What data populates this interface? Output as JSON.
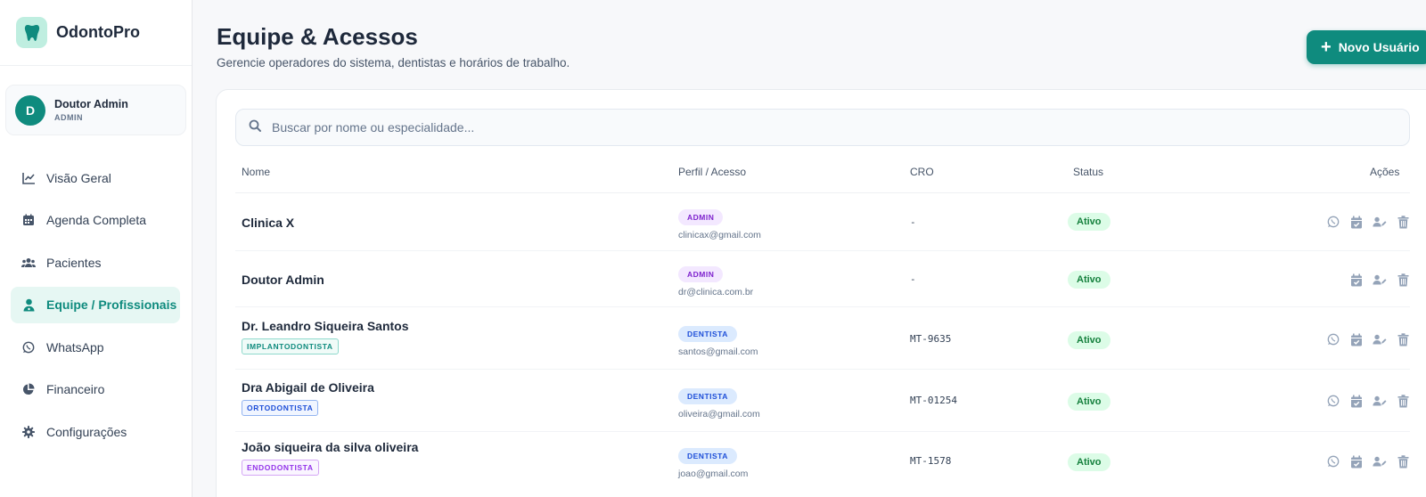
{
  "app": {
    "name": "OdontoPro"
  },
  "user": {
    "initial": "D",
    "name": "Doutor Admin",
    "role": "ADMIN"
  },
  "sidebar": {
    "items": [
      {
        "label": "Visão Geral",
        "icon": "chart-line-icon"
      },
      {
        "label": "Agenda Completa",
        "icon": "calendar-icon"
      },
      {
        "label": "Pacientes",
        "icon": "users-icon"
      },
      {
        "label": "Equipe / Profissionais",
        "icon": "user-doctor-icon",
        "active": true
      },
      {
        "label": "WhatsApp",
        "icon": "whatsapp-icon"
      },
      {
        "label": "Financeiro",
        "icon": "pie-chart-icon"
      },
      {
        "label": "Configurações",
        "icon": "gear-icon"
      }
    ]
  },
  "header": {
    "title": "Equipe & Acessos",
    "subtitle": "Gerencie operadores do sistema, dentistas e horários de trabalho.",
    "new_user_label": "Novo Usuário"
  },
  "search": {
    "placeholder": "Buscar por nome ou especialidade..."
  },
  "table": {
    "columns": {
      "name": "Nome",
      "profile": "Perfil / Acesso",
      "cro": "CRO",
      "status": "Status",
      "actions": "Ações"
    },
    "rows": [
      {
        "name": "Clinica X",
        "specialty": "",
        "role": "ADMIN",
        "email": "clinicax@gmail.com",
        "cro": "-",
        "status": "Ativo",
        "whatsapp": true
      },
      {
        "name": "Doutor Admin",
        "specialty": "",
        "role": "ADMIN",
        "email": "dr@clinica.com.br",
        "cro": "-",
        "status": "Ativo",
        "whatsapp": false
      },
      {
        "name": "Dr. Leandro Siqueira Santos",
        "specialty": "IMPLANTODONTISTA",
        "role": "DENTISTA",
        "email": "santos@gmail.com",
        "cro": "MT-9635",
        "status": "Ativo",
        "whatsapp": true
      },
      {
        "name": "Dra Abigail de Oliveira",
        "specialty": "ORTODONTISTA",
        "role": "DENTISTA",
        "email": "oliveira@gmail.com",
        "cro": "MT-01254",
        "status": "Ativo",
        "whatsapp": true
      },
      {
        "name": "João siqueira da silva oliveira",
        "specialty": "ENDODONTISTA",
        "role": "DENTISTA",
        "email": "joao@gmail.com",
        "cro": "MT-1578",
        "status": "Ativo",
        "whatsapp": true
      }
    ]
  },
  "colors": {
    "brand": "#0f8b7e",
    "active_nav_bg": "#e6f7f3",
    "status_active_bg": "#dcfce7",
    "status_active_text": "#15803d",
    "admin_badge_bg": "#f3e8ff",
    "dentista_badge_bg": "#dbeafe",
    "implanto_tag": "#0f8b7e",
    "orto_tag": "#1d4ed8",
    "endo_tag": "#9333ea"
  }
}
